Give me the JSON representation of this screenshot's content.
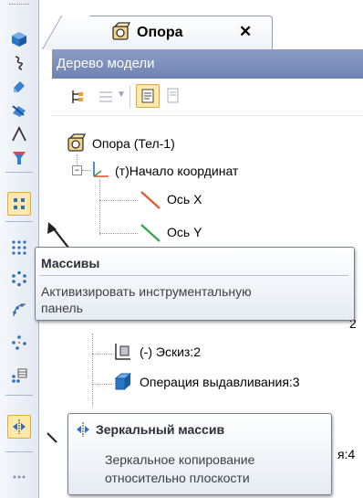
{
  "document_tab": {
    "title": "Опора",
    "close_glyph": "✕"
  },
  "panel": {
    "title": "Дерево модели"
  },
  "tree": {
    "root": "Опора (Тел-1)",
    "origin": "(т)Начало координат",
    "axis_x": "Ось X",
    "axis_y": "Ось Y",
    "partial_row": "2",
    "sketch": "(-) Эскиз:2",
    "extrude": "Операция выдавливания:3",
    "partial_row_2": "я:4"
  },
  "tooltip_arrays": {
    "title": "Массивы",
    "description_line1": "Активизировать инструментальную",
    "description_line2": "панель"
  },
  "tooltip_mirror": {
    "title": "Зеркальный массив",
    "description_line1": "Зеркальное копирование",
    "description_line2": "относительно плоскости"
  },
  "colors": {
    "panel_header_bg": "#7d8fbd",
    "axis_x": "#e4572e",
    "axis_y": "#2fa34a",
    "active_button_bg": "#ffe9a8"
  },
  "icons": [
    "cube-icon",
    "curve-icon",
    "edit-icon",
    "fillet-icon",
    "arc-icon",
    "funnel-icon",
    "array-grid-icon",
    "array-dense-icon",
    "array-circular-icon",
    "array-curve-icon",
    "array-points-icon",
    "array-table-icon",
    "mirror-array-icon"
  ]
}
